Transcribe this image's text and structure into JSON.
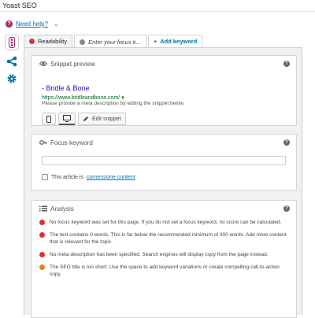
{
  "app": {
    "title": "Yoast SEO"
  },
  "help": {
    "label": "Need help?"
  },
  "colors": {
    "red": "#dc3232",
    "orange": "#ee7c1b",
    "gray": "#888888",
    "link": "#0073aa",
    "brand": "#a4286a"
  },
  "icons": {
    "help": "question-circle-icon",
    "dropdown": "chevron-down-icon",
    "side_seo": "traffic-light-icon",
    "side_social": "share-icon",
    "side_settings": "gear-icon"
  },
  "tabs": [
    {
      "label": "Readability",
      "status_color": "#dc3232"
    },
    {
      "label": "Enter your focus k...",
      "status_color": "#888888"
    },
    {
      "label": "Add keyword",
      "prefix": "+"
    }
  ],
  "snippet": {
    "heading": "Snippet preview",
    "title": "- Bridle & Bone",
    "url": "https://www.bridleandbone.com/",
    "url_arrow": "▾",
    "description": "Please provide a meta description by editing the snippet below.",
    "edit_label": "Edit snippet"
  },
  "focus": {
    "heading": "Focus keyword",
    "input_value": "",
    "cornerstone_prefix": "This article is",
    "cornerstone_link": "cornerstone content"
  },
  "analysis": {
    "heading": "Analysis",
    "results": [
      {
        "status": "red",
        "text": "No focus keyword was set for this page. If you do not set a focus keyword, no score can be calculated."
      },
      {
        "status": "red",
        "text": "The text contains 0 words. This is far below the recommended minimum of 300 words. Add more content that is relevant for the topic."
      },
      {
        "status": "red",
        "text": "No meta description has been specified. Search engines will display copy from the page instead."
      },
      {
        "status": "orange",
        "text": "The SEO title is too short. Use the space to add keyword variations or create compelling call-to-action copy."
      }
    ]
  }
}
